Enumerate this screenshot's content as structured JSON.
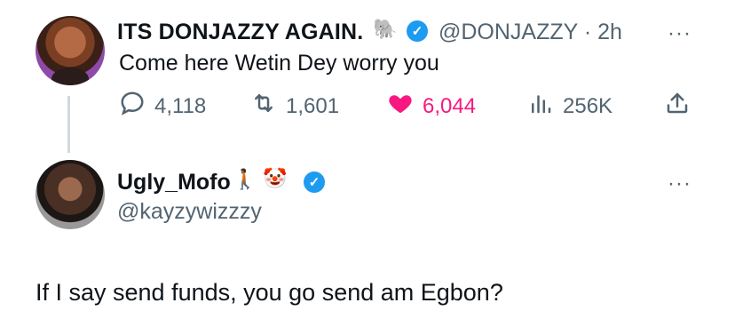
{
  "tweet1": {
    "display_name": "ITS DONJAZZY AGAIN.",
    "name_emoji": "🐘",
    "handle": "@DONJAZZY",
    "time": "· 2h",
    "text": "Come here Wetin Dey worry you",
    "stats": {
      "replies": "4,118",
      "retweets": "1,601",
      "likes": "6,044",
      "views": "256K"
    },
    "more": "···"
  },
  "tweet2": {
    "display_name": "Ugly_Mofo",
    "name_emojis": [
      "🚶🏾",
      "🤡"
    ],
    "handle": "@kayzywizzzy",
    "text": "If I say send funds, you go send am Egbon?",
    "more": "···"
  },
  "colors": {
    "verified": "#1d9bf0",
    "like": "#f91880",
    "secondary_text": "#536471",
    "thread_line": "#cfd9de"
  },
  "icons": [
    "reply-icon",
    "retweet-icon",
    "heart-icon",
    "views-icon",
    "share-icon",
    "verified-badge-icon",
    "more-options-icon"
  ]
}
